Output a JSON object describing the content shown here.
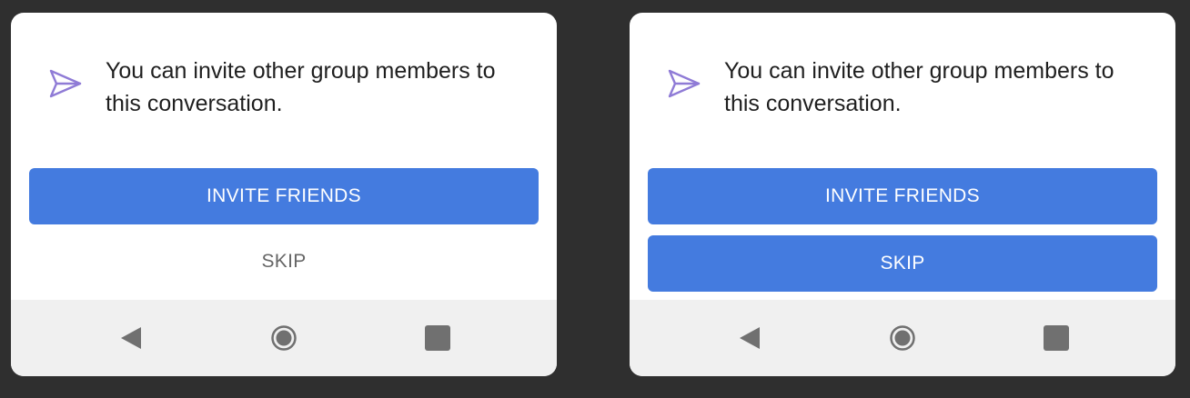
{
  "dialogs": [
    {
      "message": "You can invite other group members to this conversation.",
      "invite_label": "INVITE FRIENDS",
      "skip_label": "SKIP"
    },
    {
      "message": "You can invite other group members to this conversation.",
      "invite_label": "INVITE FRIENDS",
      "skip_label": "SKIP"
    }
  ],
  "icons": {
    "message_icon": "send-icon",
    "nav_back": "back-triangle-icon",
    "nav_home": "home-circle-icon",
    "nav_recent": "recent-apps-square-icon"
  },
  "colors": {
    "background": "#2f2f2f",
    "card": "#ffffff",
    "primary_button": "#447bdf",
    "button_text": "#ffffff",
    "skip_text": "#666666",
    "icon_accent": "#8f7bd6",
    "navbar": "#f0f0f0",
    "nav_icon": "#707070"
  }
}
